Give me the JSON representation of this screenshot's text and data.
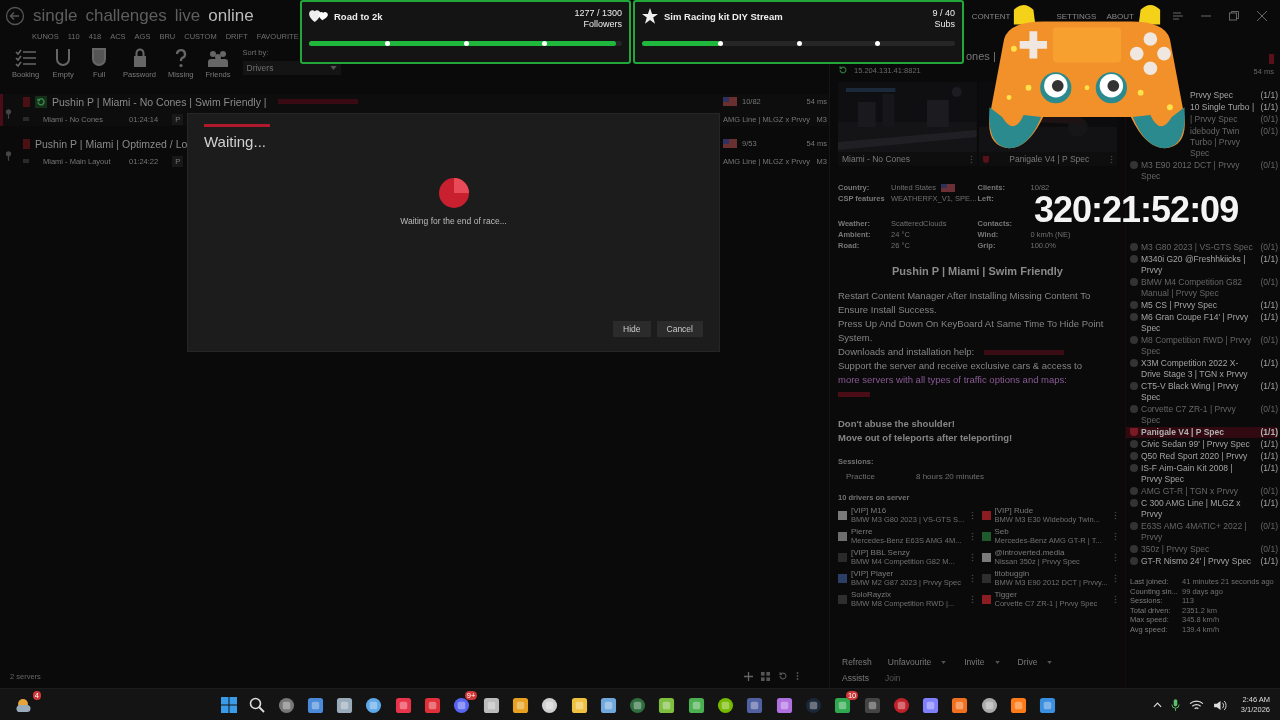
{
  "app": {
    "modes": [
      {
        "label": "single",
        "selected": false
      },
      {
        "label": "challenges",
        "selected": false
      },
      {
        "label": "live",
        "selected": false
      },
      {
        "label": "online",
        "selected": true
      }
    ],
    "sources": [
      "KUNOS",
      "110",
      "418",
      "ACS",
      "AGS",
      "BRU",
      "CUSTOM",
      "DRIFT",
      "FAVOURITE"
    ],
    "top_links": [
      "CONTENT",
      "SETTINGS",
      "ABOUT"
    ],
    "filters": [
      "Booking",
      "Empty",
      "Full",
      "Password",
      "Missing",
      "Friends"
    ],
    "sort": {
      "label": "Sort by:",
      "value": "Drivers"
    },
    "servers": [
      {
        "name": "Pushin P | Miami - No Cones | Swim Friendly |",
        "track": "Miami - No Cones",
        "time": "01:24:14",
        "badge": "P",
        "clients": "10/82",
        "ping": "54 ms",
        "car": "AMG Line | MLGZ x Prvvy",
        "class": "M3",
        "selected": true
      },
      {
        "name": "Pushin P | Miami | Optimzed / Lo",
        "track": "Miami - Main Layout",
        "time": "01:24:22",
        "badge": "P",
        "clients": "9/53",
        "ping": "54 ms",
        "car": "AMG Line | MLGZ x Prvvy",
        "class": "M3",
        "selected": false
      }
    ],
    "server_count": "2 servers"
  },
  "details": {
    "heading": "ones |",
    "address": "15.204.131.41:8821",
    "track": "Miami - No Cones",
    "car": "Panigale V4 | P Spec",
    "info": [
      {
        "label": "Country:",
        "value": "United States"
      },
      {
        "label": "Clients:",
        "value": "10/82"
      },
      {
        "label": "CSP features",
        "value": "WEATHERFX_V1, SPE..."
      },
      {
        "label": "Left:"
      },
      {
        "label": "Weather:",
        "value": "ScatteredClouds"
      },
      {
        "label": "Contacts:"
      },
      {
        "label": "Ambient:",
        "value": "24 °C"
      },
      {
        "label": "Wind:",
        "value": "0 km/h (NE)"
      },
      {
        "label": "Road:",
        "value": "26 °C"
      },
      {
        "label": "Grip:",
        "value": "100.0%"
      }
    ],
    "title": "Pushin P | Miami | Swim Friendly",
    "description": [
      {
        "text": "Restart Content Manager After Installing Missing Content To Ensure Install Success."
      },
      {
        "text": "Press Up And Down On KeyBoard At Same Time To Hide Point System."
      },
      {
        "text": "Downloads and installation help:"
      },
      {
        "text": "Support the server and receive exclusive cars & access to",
        "link": "more servers with all types of traffic options and maps:"
      }
    ],
    "warnings": [
      "Don't abuse the shoulder!",
      "Move out of teleports after teleporting!"
    ],
    "sessions_label": "Sessions:",
    "sessions": [
      {
        "name": "Practice",
        "duration": "8 hours 20 minutes"
      }
    ],
    "drivers_label": "10 drivers on server",
    "drivers": [
      {
        "name": "[VIP] M16",
        "car": "BMW M3 G80 2023 | VS-GTS S...",
        "color": "#7a7a7a"
      },
      {
        "name": "[VIP] Rude",
        "car": "BMW M3 E30 Widebody Twin...",
        "color": "#8a1c22"
      },
      {
        "name": "Pierre",
        "car": "Mercedes-Benz E63S AMG 4M...",
        "color": "#6e6e6e"
      },
      {
        "name": "Seb",
        "car": "Mercedes-Benz AMG GT-R | T...",
        "color": "#1f5a2c"
      },
      {
        "name": "[VIP] BBL Senzy",
        "car": "BMW M4 Competition G82 M...",
        "color": "#2a2a2a"
      },
      {
        "name": "@introverted.media",
        "car": "Nissan 350z | Prvvy Spec",
        "color": "#7a7a7a"
      },
      {
        "name": "[VIP] Player",
        "car": "BMW M2 G87 2023 | Prvvy Spec",
        "color": "#2c3e66"
      },
      {
        "name": "titobuggin",
        "car": "BMW M3 E90 2012 DCT | Prvvy...",
        "color": "#2e2e2e"
      },
      {
        "name": "SoloRayzix",
        "car": "BMW M8 Competition RWD |...",
        "color": "#2e2e2e"
      },
      {
        "name": "Tigger",
        "car": "Corvette C7 ZR-1 | Prvvy Spec",
        "color": "#8a1c22"
      }
    ],
    "actions": [
      "Refresh",
      "Unfavourite",
      "Invite",
      "Drive"
    ],
    "assists": "Assists",
    "join": "Join"
  },
  "cars": {
    "ping": "54 ms",
    "items": [
      {
        "name": "Prvvy Spec",
        "count": "(1/1)",
        "available": true,
        "selected": false
      },
      {
        "name": "10 Single Turbo |",
        "count": "(1/1)",
        "available": true,
        "selected": false
      },
      {
        "name": "| Prvvy Spec",
        "count": "(0/1)",
        "available": false,
        "selected": false
      },
      {
        "name": "idebody Twin Turbo | Prvvy Spec",
        "count": "(0/1)",
        "available": false,
        "selected": false
      },
      {
        "name": "M3 E90 2012 DCT | Prvvy Spec",
        "count": "(0/1)",
        "available": false,
        "selected": false
      },
      {
        "name": "M3 G80 2023 | VS-GTS Spec",
        "count": "(0/1)",
        "available": false,
        "selected": false
      },
      {
        "name": "M340i G20 @Freshhkiicks | Prvvy",
        "count": "(1/1)",
        "available": true,
        "selected": false
      },
      {
        "name": "BMW M4 Competition G82 Manual | Prvvy Spec",
        "count": "(0/1)",
        "available": false,
        "selected": false
      },
      {
        "name": "M5 CS | Prvvy Spec",
        "count": "(1/1)",
        "available": true,
        "selected": false
      },
      {
        "name": "M6 Gran Coupe F14' | Prvvy Spec",
        "count": "(1/1)",
        "available": true,
        "selected": false
      },
      {
        "name": "M8 Competition RWD | Prvvy Spec",
        "count": "(0/1)",
        "available": false,
        "selected": false
      },
      {
        "name": "X3M Competition 2022 X-Drive Stage 3 | TGN x Prvvy",
        "count": "(1/1)",
        "available": true,
        "selected": false
      },
      {
        "name": "CT5-V Black Wing | Prvvy Spec",
        "count": "(1/1)",
        "available": true,
        "selected": false
      },
      {
        "name": "Corvette C7 ZR-1 | Prvvy Spec",
        "count": "(0/1)",
        "available": false,
        "selected": false
      },
      {
        "name": "Panigale V4 | P Spec",
        "count": "(1/1)",
        "available": true,
        "selected": true
      },
      {
        "name": "Civic Sedan 99' | Prvvy Spec",
        "count": "(1/1)",
        "available": true,
        "selected": false
      },
      {
        "name": "Q50 Red Sport 2020 | Prvvy",
        "count": "(1/1)",
        "available": true,
        "selected": false
      },
      {
        "name": "IS-F Aim-Gain Kit 2008 | Prvvy Spec",
        "count": "(1/1)",
        "available": true,
        "selected": false
      },
      {
        "name": "AMG GT-R | TGN x Prvvy",
        "count": "(0/1)",
        "available": false,
        "selected": false
      },
      {
        "name": "C 300 AMG Line | MLGZ x Prvvy",
        "count": "(1/1)",
        "available": true,
        "selected": false
      },
      {
        "name": "E63S AMG 4MATIC+ 2022 | Prvvy",
        "count": "(0/1)",
        "available": false,
        "selected": false
      },
      {
        "name": "350z | Prvvy Spec",
        "count": "(0/1)",
        "available": false,
        "selected": false
      },
      {
        "name": "GT-R Nismo 24' | Prvvy Spec",
        "count": "(1/1)",
        "available": true,
        "selected": false
      }
    ],
    "stats": [
      {
        "label": "Last joined:",
        "value": "41 minutes 21 seconds ago"
      },
      {
        "label": "Counting sin...",
        "value": "99 days ago"
      },
      {
        "label": "Sessions:",
        "value": "113"
      },
      {
        "label": "Total driven:",
        "value": "2351.2 km"
      },
      {
        "label": "Max speed:",
        "value": "345.8 km/h"
      },
      {
        "label": "Avg speed:",
        "value": "139.4 km/h"
      }
    ]
  },
  "dialog": {
    "title": "Waiting...",
    "message": "Waiting for the end of race...",
    "buttons": [
      "Hide",
      "Cancel"
    ]
  },
  "goals": [
    {
      "title": "Road to 2k",
      "count": "1277 / 1300",
      "unit": "Followers",
      "level": 0.98
    },
    {
      "title": "Sim Racing kit DIY Stream",
      "count": "9 / 40",
      "unit": "Subs",
      "level": 0.25
    }
  ],
  "timer": "320:21:52:09",
  "taskbar": {
    "widgets_badge": "4",
    "chat_badge": "9+",
    "game_badge": "10",
    "time": "2:46 AM",
    "date": "3/1/2026"
  }
}
